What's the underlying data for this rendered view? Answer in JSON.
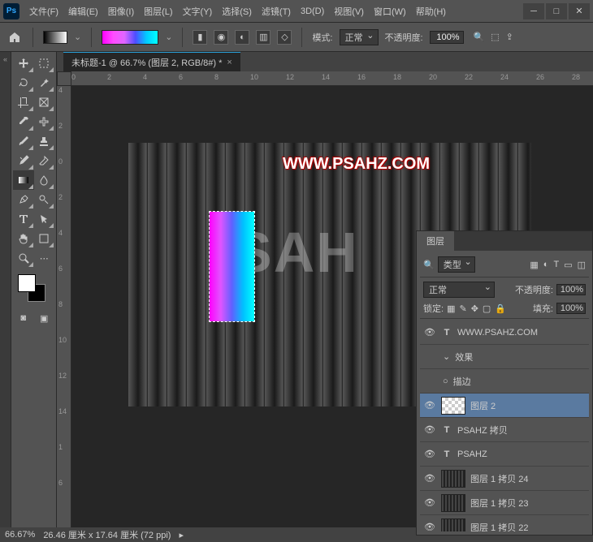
{
  "menu": {
    "file": "文件(F)",
    "edit": "编辑(E)",
    "image": "图像(I)",
    "layer": "图层(L)",
    "type": "文字(Y)",
    "select": "选择(S)",
    "filter": "滤镜(T)",
    "threeD": "3D(D)",
    "view": "视图(V)",
    "window": "窗口(W)",
    "help": "帮助(H)"
  },
  "options": {
    "mode_label": "模式:",
    "mode_value": "正常",
    "opacity_label": "不透明度:",
    "opacity_value": "100%"
  },
  "doc": {
    "tab": "未标题-1 @ 66.7% (图层 2, RGB/8#) *"
  },
  "ruler_h": [
    "0",
    "2",
    "4",
    "6",
    "8",
    "10",
    "12",
    "14",
    "16",
    "18",
    "20",
    "22",
    "24",
    "26",
    "28"
  ],
  "ruler_v": [
    "4",
    "2",
    "0",
    "2",
    "4",
    "6",
    "8",
    "10",
    "12",
    "14",
    "1",
    "6"
  ],
  "canvas": {
    "ghost": "SAH",
    "watermark": "WWW.PSAHZ.COM"
  },
  "panel": {
    "tab": "图层",
    "filter": "类型",
    "blend": "正常",
    "opacity_label": "不透明度:",
    "opacity_value": "100%",
    "lock_label": "锁定:",
    "fill_label": "填充:",
    "fill_value": "100%",
    "layers": [
      {
        "name": "WWW.PSAHZ.COM",
        "type": "T"
      },
      {
        "name": "效果",
        "child": true,
        "caret": "⌄"
      },
      {
        "name": "描边",
        "child": true,
        "bullet": "○"
      },
      {
        "name": "图层 2",
        "type": "thumb",
        "selected": true
      },
      {
        "name": "PSAHZ 拷贝",
        "type": "T"
      },
      {
        "name": "PSAHZ",
        "type": "T"
      },
      {
        "name": "图层 1 拷贝 24",
        "type": "stripe"
      },
      {
        "name": "图层 1 拷贝 23",
        "type": "stripe"
      },
      {
        "name": "图层 1 拷贝 22",
        "type": "stripe"
      }
    ]
  },
  "status": {
    "zoom": "66.67%",
    "dims": "26.46 厘米 x 17.64 厘米 (72 ppi)"
  }
}
